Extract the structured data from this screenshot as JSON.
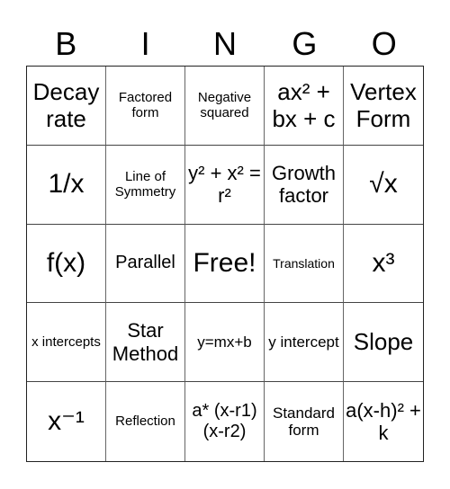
{
  "header": {
    "letters": [
      "B",
      "I",
      "N",
      "G",
      "O"
    ]
  },
  "board": {
    "cells": [
      [
        "Decay rate",
        "Factored form",
        "Negative squared",
        "ax² + bx + c",
        "Vertex Form"
      ],
      [
        "1/x",
        "Line of Symmetry",
        "y² + x² = r²",
        "Growth factor",
        "√x"
      ],
      [
        "f(x)",
        "Parallel",
        "Free!",
        "Translation",
        "x³"
      ],
      [
        "x intercepts",
        "Star Method",
        "y=mx+b",
        "y intercept",
        "Slope"
      ],
      [
        "x⁻¹",
        "Reflection",
        "a* (x-r1) (x-r2)",
        "Standard form",
        "a(x-h)² + k"
      ]
    ],
    "free_space": "Free!"
  }
}
